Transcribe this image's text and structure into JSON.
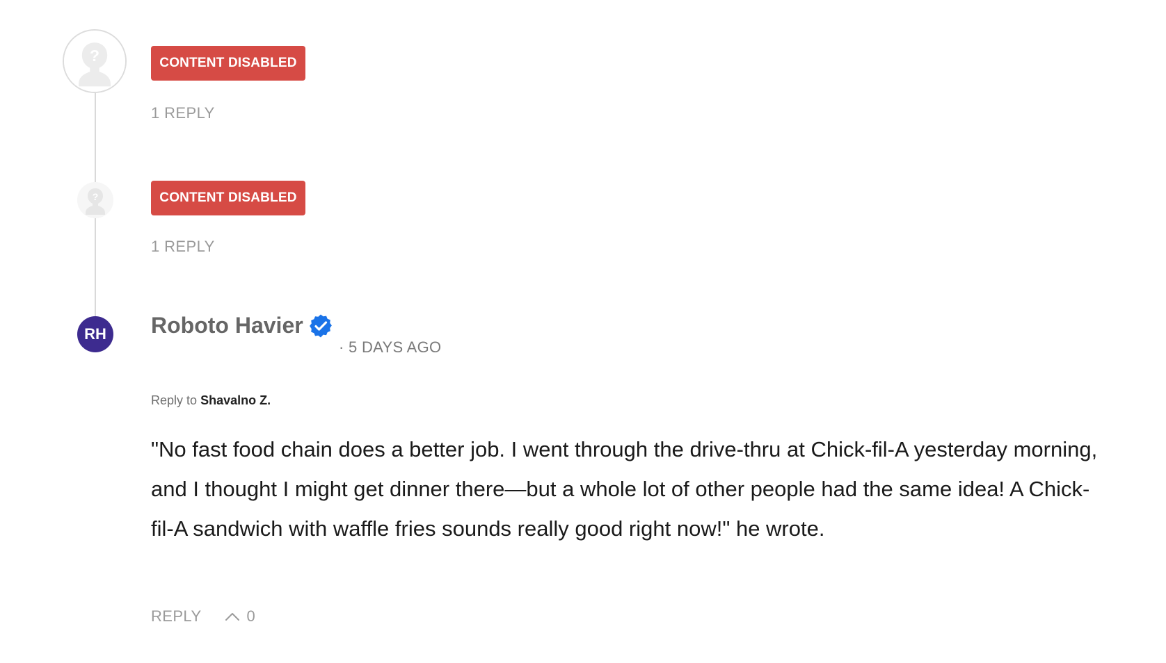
{
  "comments": [
    {
      "avatar_icon": "anonymous-user-icon",
      "status_label": "CONTENT DISABLED",
      "status_color": "#d64b45",
      "replies_label": "1 REPLY"
    },
    {
      "avatar_icon": "anonymous-user-icon",
      "status_label": "CONTENT DISABLED",
      "status_color": "#d64b45",
      "replies_label": "1 REPLY"
    }
  ],
  "reply": {
    "avatar_initials": "RH",
    "avatar_color": "#3d2b8f",
    "author": "Roboto Havier",
    "verified_icon": "verified-badge-icon",
    "verified_color": "#1a73e8",
    "timestamp": "· 5 DAYS AGO",
    "reply_to_prefix": "Reply to",
    "reply_to_name": "Shavalno Z.",
    "body": "\"No fast food chain does a better job. I went through the drive-thru at Chick-fil-A yesterday morning, and I thought I might get dinner there—but a whole lot of other people had the same idea! A Chick-fil-A sandwich with waffle fries sounds really good right now!\" he wrote.",
    "actions": {
      "reply_label": "REPLY",
      "upvote_icon": "chevron-up-icon",
      "upvote_count": "0"
    }
  }
}
